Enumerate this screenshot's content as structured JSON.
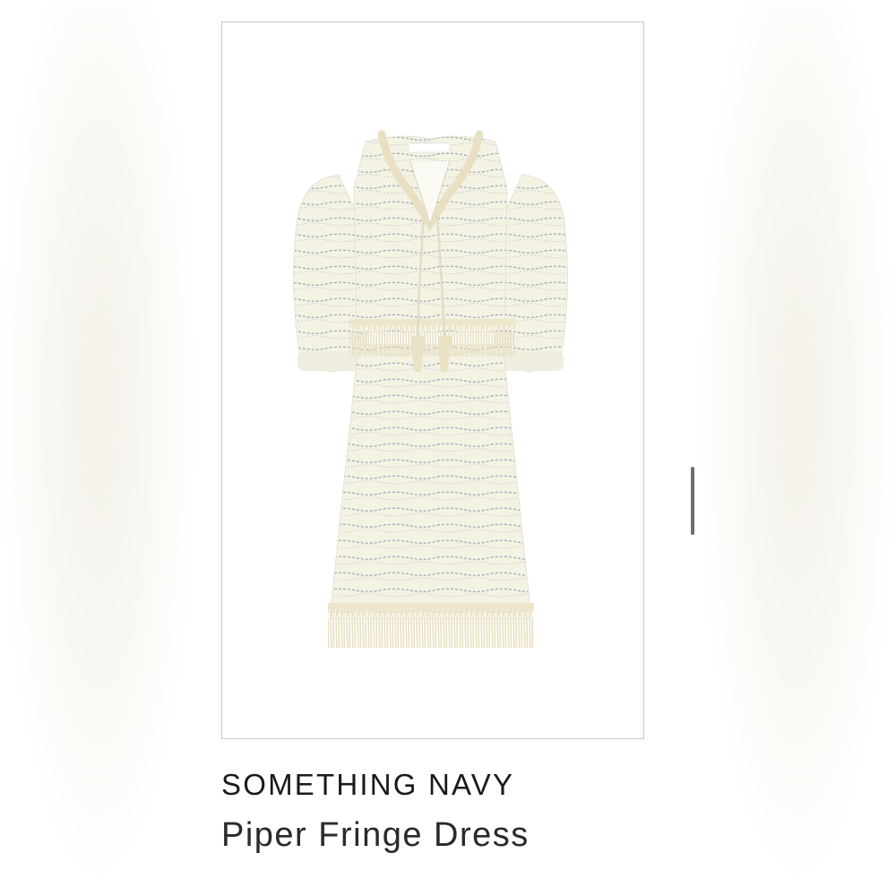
{
  "product": {
    "brand": "SOMETHING NAVY",
    "name": "Piper Fringe Dress",
    "image": {
      "subject": "dress-image",
      "colors": {
        "fabric": "#f4f2e3",
        "stripe": "#8a9bb0",
        "fringe": "#ece3c8"
      }
    }
  },
  "scrollbar": {
    "color": "#6e6e6e"
  }
}
